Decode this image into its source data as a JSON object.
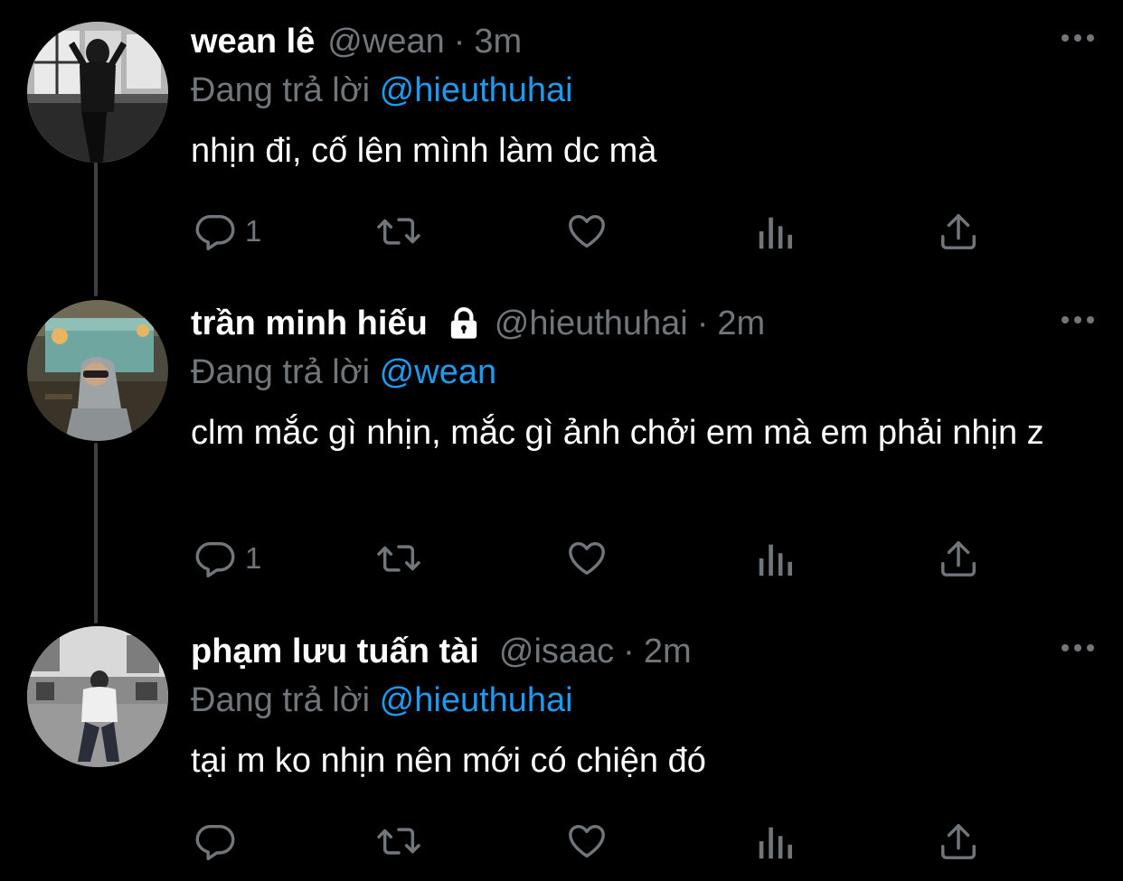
{
  "tweets": [
    {
      "name": "wean lê",
      "handle": "@wean",
      "separator": "·",
      "time": "3m",
      "replying_prefix": "Đang trả lời",
      "replying_to": "@hieuthuhai",
      "text": "nhịn đi, cố lên mình làm dc mà",
      "reply_count": "1",
      "locked": false
    },
    {
      "name": "trần minh hiếu",
      "handle": "@hieuthuhai",
      "separator": "·",
      "time": "2m",
      "replying_prefix": "Đang trả lời",
      "replying_to": "@wean",
      "text": "clm mắc gì nhịn, mắc gì ảnh chởi em mà em phải nhịn z",
      "reply_count": "1",
      "locked": true
    },
    {
      "name": "phạm lưu tuấn tài",
      "handle": "@isaac",
      "separator": "·",
      "time": "2m",
      "replying_prefix": "Đang trả lời",
      "replying_to": "@hieuthuhai",
      "text": "tại m ko nhịn nên mới có chiện đó",
      "reply_count": "",
      "locked": false
    }
  ],
  "icons": {
    "more": "more-dots-icon",
    "lock": "lock-icon",
    "reply": "reply-bubble-icon",
    "retweet": "retweet-icon",
    "like": "heart-icon",
    "views": "views-bars-icon",
    "share": "share-upload-icon"
  },
  "colors": {
    "background": "#000000",
    "text": "#ffffff",
    "muted": "#71767b",
    "accent": "#1d9bf0",
    "thread_line": "#3e4144"
  }
}
